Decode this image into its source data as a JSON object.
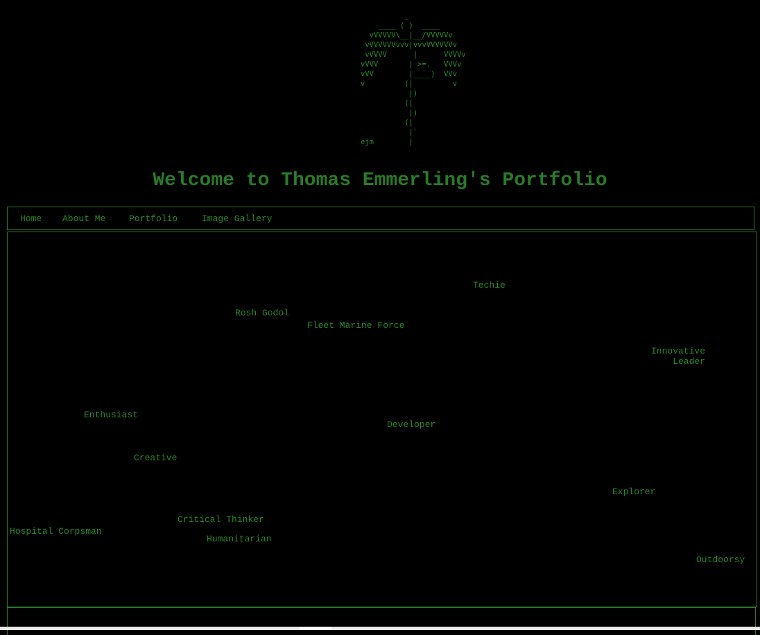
{
  "header": {
    "ascii_art": "          _\n    ____ ( )  ____\n  vVVVVV\\__|__/VVVVVv\n vVVVVVVvvv|vvvVVVVVVv\n vVVVV      |      VVVVv\nvVVV       | >=.   VVVv\nvVV        |____)  VVv\nv         (|         v\n           |)\n          (|\n           |)\n          (|\n           |`\nejm        |",
    "title": "Welcome to Thomas Emmerling's Portfolio"
  },
  "nav": {
    "items": [
      {
        "label": "Home"
      },
      {
        "label": "About Me"
      },
      {
        "label": "Portfolio"
      },
      {
        "label": "Image Gallery"
      }
    ]
  },
  "word_cloud": {
    "words": [
      {
        "text": "Techie"
      },
      {
        "text": "Rosh Godol"
      },
      {
        "text": "Fleet Marine Force"
      },
      {
        "text": "Innovative\nLeader"
      },
      {
        "text": "Enthusiast"
      },
      {
        "text": "Developer"
      },
      {
        "text": "Creative"
      },
      {
        "text": "Explorer"
      },
      {
        "text": "Critical Thinker"
      },
      {
        "text": "Hospital Corpsman"
      },
      {
        "text": "Humanitarian"
      },
      {
        "text": "Outdoorsy"
      }
    ]
  },
  "colors": {
    "background": "#000000",
    "text": "#2a8a2a",
    "border": "#2a7a2a"
  }
}
